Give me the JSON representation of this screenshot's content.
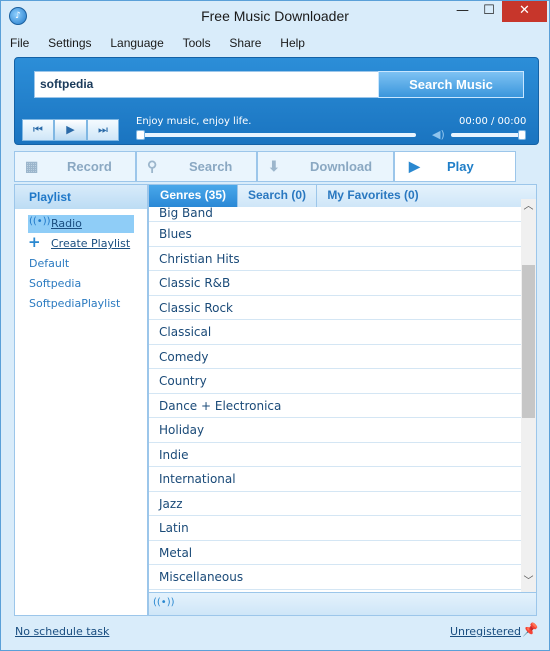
{
  "window": {
    "title": "Free Music Downloader",
    "minimize_glyph": "—",
    "maximize_glyph": "☐",
    "close_glyph": "✕",
    "app_icon": "app-logo-icon"
  },
  "menu": [
    "File",
    "Settings",
    "Language",
    "Tools",
    "Share",
    "Help"
  ],
  "search": {
    "query": "softpedia",
    "button_label": "Search Music"
  },
  "player": {
    "tagline": "Enjoy music, enjoy life.",
    "time": "00:00 / 00:00",
    "progress": 0,
    "volume": 1.0,
    "prev_glyph": "⏮",
    "play_glyph": "▶",
    "next_glyph": "⏭"
  },
  "mode_tabs": {
    "record": "Record",
    "search": "Search",
    "download": "Download",
    "play": "Play",
    "active": "Play"
  },
  "left_panel": {
    "header": "Playlist",
    "radio_label": "Radio",
    "create_label": "Create Playlist",
    "playlists": [
      "Default",
      "Softpedia",
      "SoftpediaPlaylist"
    ]
  },
  "sub_tabs": {
    "genres": "Genres (35)",
    "search": "Search (0)",
    "favorites": "My Favorites (0)"
  },
  "genres": [
    "Big Band",
    "Blues",
    "Christian Hits",
    "Classic R&B",
    "Classic Rock",
    "Classical",
    "Comedy",
    "Country",
    "Dance + Electronica",
    "Holiday",
    "Indie",
    "International",
    "Jazz",
    "Latin",
    "Metal",
    "Miscellaneous"
  ],
  "status": {
    "left": "No schedule task",
    "right": "Unregistered"
  },
  "colors": {
    "accent": "#1f78c8",
    "panel_bg": "#d9ecfa",
    "close_button": "#c7362b"
  }
}
